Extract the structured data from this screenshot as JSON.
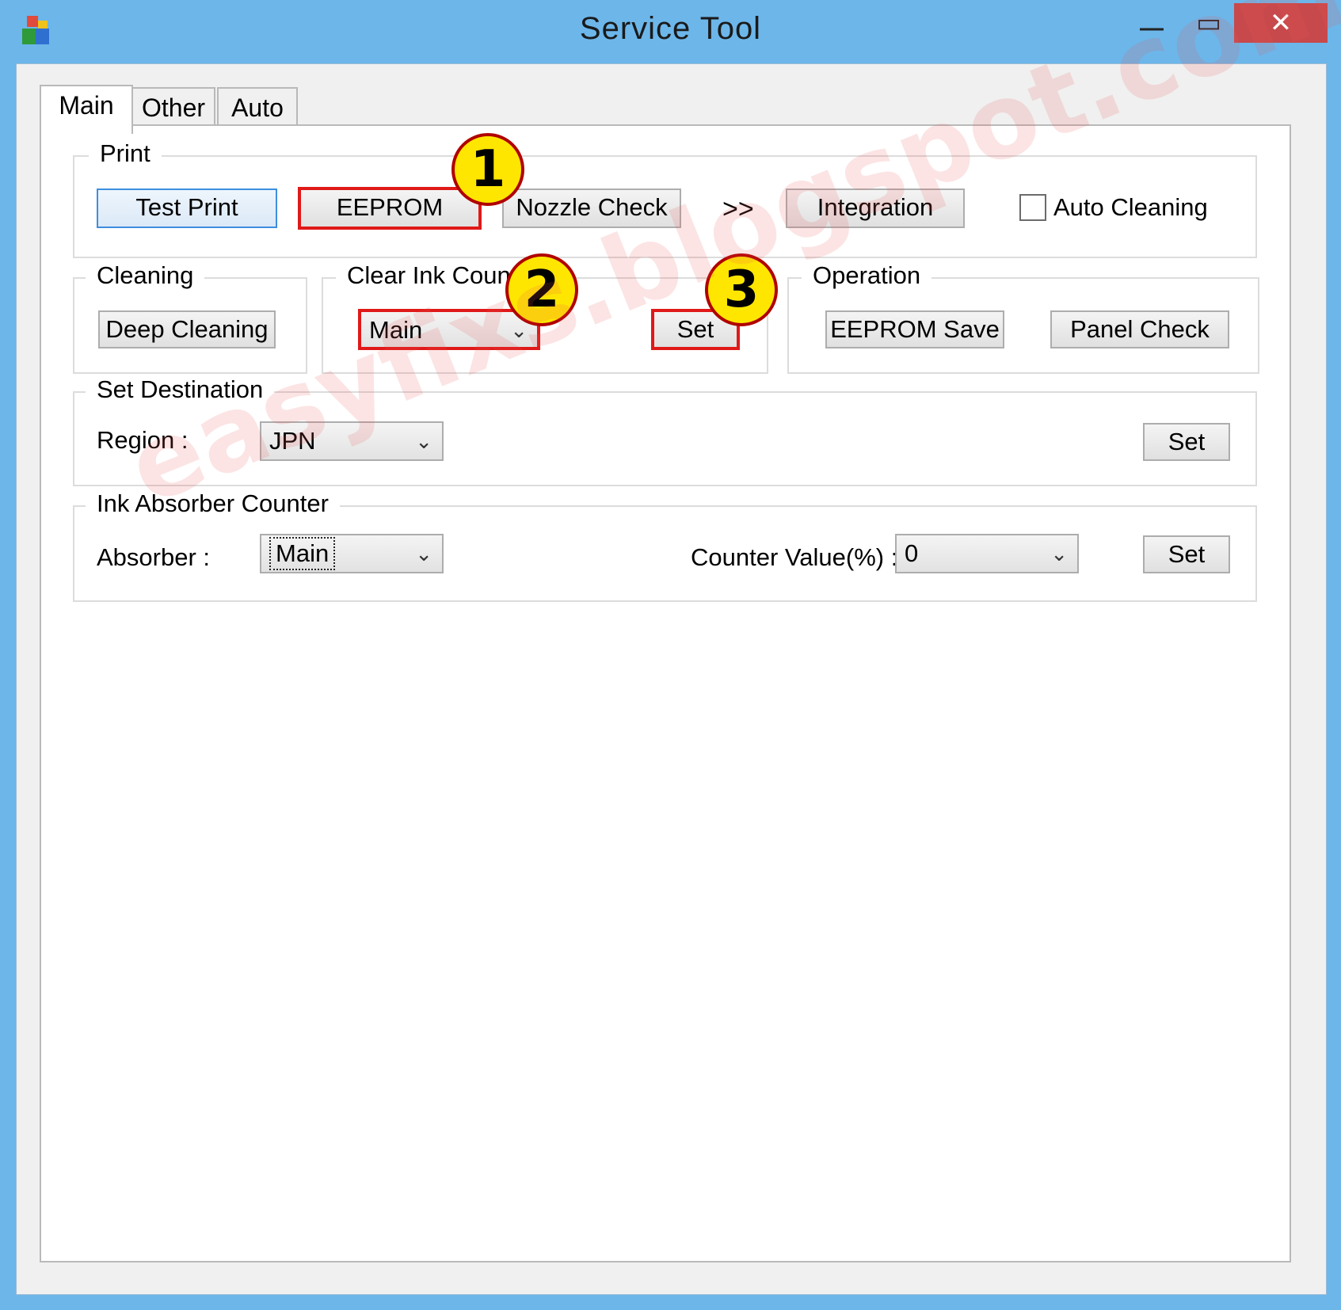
{
  "window": {
    "title": "Service Tool",
    "minimize_glyph": "—",
    "maximize_glyph": "▭",
    "close_glyph": "✕",
    "app_icon": "app-icon"
  },
  "tabs": [
    {
      "label": "Main",
      "active": true
    },
    {
      "label": "Other",
      "active": false
    },
    {
      "label": "Auto",
      "active": false
    }
  ],
  "print_group": {
    "label": "Print",
    "test_print": "Test Print",
    "eeprom": "EEPROM",
    "nozzle_check": "Nozzle Check",
    "more": ">>",
    "integration": "Integration",
    "auto_cleaning": "Auto Cleaning",
    "auto_cleaning_checked": false
  },
  "cleaning_group": {
    "label": "Cleaning",
    "deep_cleaning": "Deep Cleaning"
  },
  "clear_ink_group": {
    "label": "Clear Ink Count",
    "selected": "Main",
    "set": "Set"
  },
  "operation_group": {
    "label": "Operation",
    "eeprom_save": "EEPROM Save",
    "panel_check": "Panel Check"
  },
  "destination_group": {
    "label": "Set Destination",
    "region_label": "Region :",
    "region_value": "JPN",
    "set": "Set"
  },
  "absorber_group": {
    "label": "Ink Absorber Counter",
    "absorber_label": "Absorber :",
    "absorber_value": "Main",
    "counter_label": "Counter Value(%) :",
    "counter_value": "0",
    "set": "Set"
  },
  "annotations": {
    "step1": "1",
    "step2": "2",
    "step3": "3",
    "highlight_color": "#e01919",
    "marker_color": "#ffe600"
  },
  "watermark": "easyfixs.blogspot.com",
  "colors": {
    "titlebar": "#6cb6ea",
    "close": "#c7494b"
  }
}
